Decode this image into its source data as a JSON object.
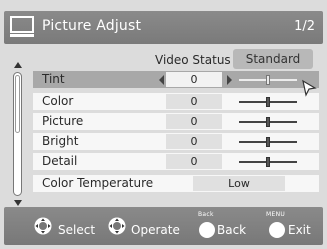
{
  "header": {
    "title": "Picture Adjust",
    "page": "1/2"
  },
  "video_status": {
    "label": "Video Status",
    "value": "Standard"
  },
  "rows": [
    {
      "label": "Tint",
      "value": "0",
      "level": 0.5
    },
    {
      "label": "Color",
      "value": "0",
      "level": 0.5
    },
    {
      "label": "Picture",
      "value": "0",
      "level": 0.5
    },
    {
      "label": "Bright",
      "value": "0",
      "level": 0.5
    },
    {
      "label": "Detail",
      "value": "0",
      "level": 0.5
    },
    {
      "label": "Color Temperature",
      "value": "Low"
    }
  ],
  "footer": {
    "select": "Select",
    "operate": "Operate",
    "back_hint": "Back",
    "back": "Back",
    "menu_hint": "MENU",
    "exit": "Exit"
  },
  "colors": {
    "title_bar": "#808080",
    "selected_row": "#a8a8a8",
    "row": "#f7f7f7"
  },
  "icons": [
    "tv-icon",
    "scroll-up-icon",
    "scroll-down-icon",
    "pointer-cursor-icon",
    "joystick-select-icon",
    "joystick-operate-icon",
    "back-button-icon",
    "exit-button-icon"
  ]
}
